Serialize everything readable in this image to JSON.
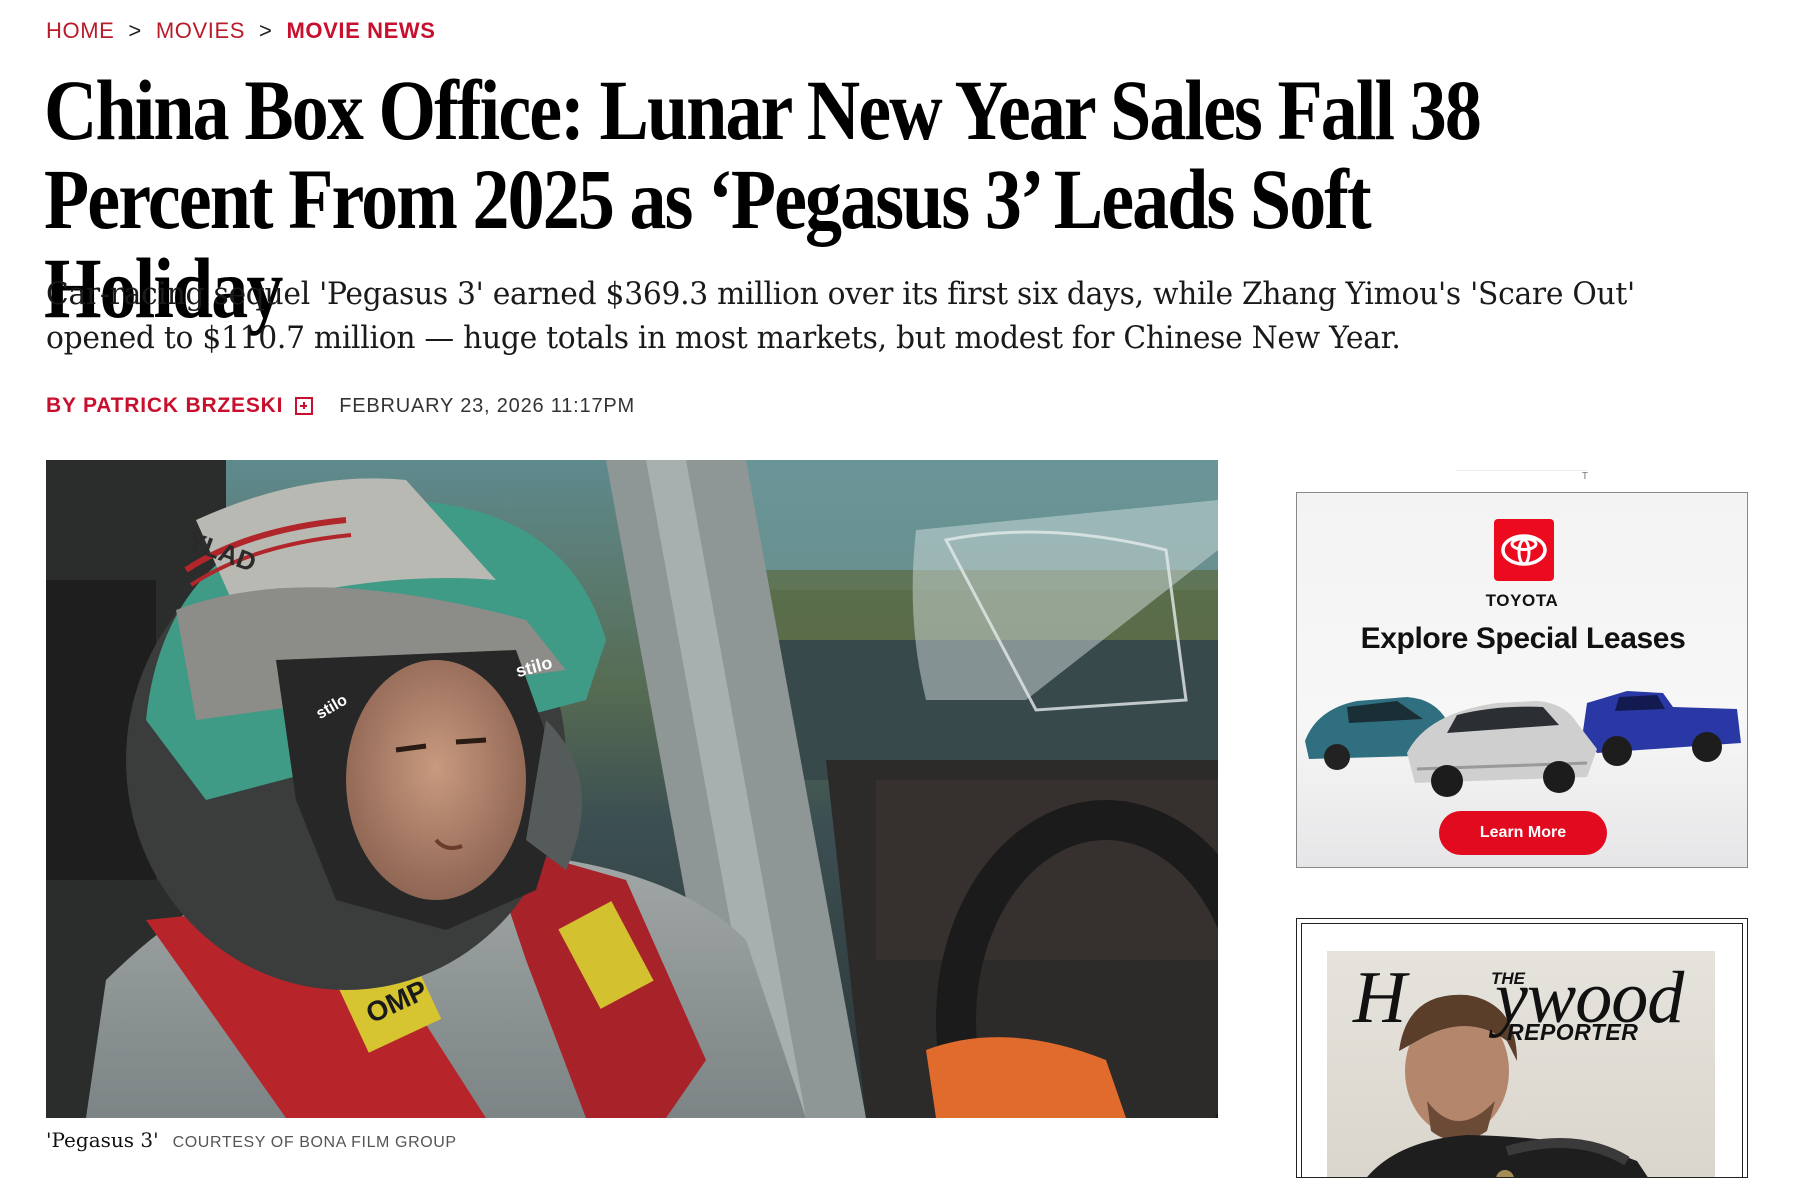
{
  "breadcrumb": {
    "home": "HOME",
    "movies": "MOVIES",
    "current": "MOVIE NEWS",
    "separator": ">"
  },
  "article": {
    "headline": "China Box Office: Lunar New Year Sales Fall 38 Percent From 2025 as ‘Pegasus 3’ Leads Soft Holiday",
    "dek": "Car-racing sequel 'Pegasus 3' earned $369.3 million over its first six days, while Zhang Yimou's 'Scare Out' opened to $110.7 million — huge totals in most markets, but modest for Chinese New Year.",
    "byline": "BY PATRICK BRZESKI",
    "follow_icon": "plus-box-icon",
    "date": "FEBRUARY 23, 2026 11:17PM",
    "image": {
      "caption_title": "'Pegasus 3'",
      "caption_credit": "COURTESY OF BONA FILM GROUP",
      "helmet_text": "YLAD",
      "badge_text": "stilo",
      "harness_text": "OMP"
    }
  },
  "sidebar": {
    "ad": {
      "brand": "TOYOTA",
      "headline": "Explore Special Leases",
      "cta": "Learn More",
      "tag": "T"
    },
    "magazine": {
      "title_the": "THE",
      "title_h": "H",
      "title_rest": "ywood",
      "title_reporter": "REPORTER"
    }
  },
  "colors": {
    "accent": "#c8102e",
    "toyota_red": "#eb0a1e"
  }
}
